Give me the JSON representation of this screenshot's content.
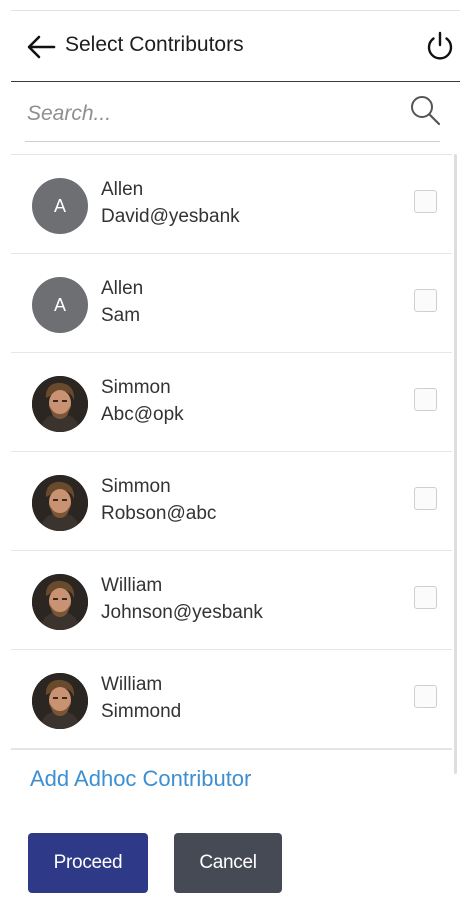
{
  "header": {
    "title": "Select Contributors",
    "back_icon": "arrow-left-icon",
    "power_icon": "power-icon"
  },
  "search": {
    "placeholder": "Search...",
    "value": "",
    "icon": "search-icon"
  },
  "contributors": [
    {
      "line1": "Allen",
      "line2": "David@yesbank",
      "avatar_type": "initial",
      "initial": "A",
      "checked": false
    },
    {
      "line1": "Allen",
      "line2": "Sam",
      "avatar_type": "initial",
      "initial": "A",
      "checked": false
    },
    {
      "line1": "Simmon",
      "line2": "Abc@opk",
      "avatar_type": "photo",
      "checked": false
    },
    {
      "line1": "Simmon",
      "line2": "Robson@abc",
      "avatar_type": "photo",
      "checked": false
    },
    {
      "line1": "William",
      "line2": "Johnson@yesbank",
      "avatar_type": "photo",
      "checked": false
    },
    {
      "line1": "William",
      "line2": "Simmond",
      "avatar_type": "photo",
      "checked": false
    }
  ],
  "actions": {
    "adhoc_label": "Add Adhoc Contributor",
    "proceed_label": "Proceed",
    "cancel_label": "Cancel"
  },
  "colors": {
    "link": "#3d8fd1",
    "proceed": "#2e3a87",
    "cancel": "#454a55",
    "initial_avatar": "#6d6f72"
  }
}
